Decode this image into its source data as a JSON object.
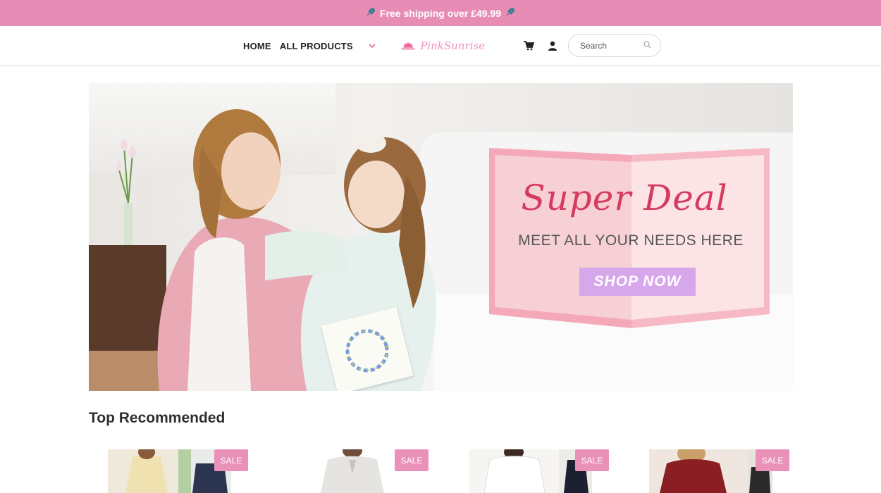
{
  "announcement": {
    "text": "Free shipping over £49.99"
  },
  "nav": {
    "home": "HOME",
    "all_products": "ALL PRODUCTS"
  },
  "logo": {
    "text": "PinkSunrise"
  },
  "search": {
    "placeholder": "Search"
  },
  "hero": {
    "title": "Super Deal",
    "subtitle": "MEET ALL YOUR NEEDS HERE",
    "cta": "SHOP NOW"
  },
  "section": {
    "title": "Top Recommended"
  },
  "products": [
    {
      "badge": "SALE"
    },
    {
      "badge": "SALE"
    },
    {
      "badge": "SALE"
    },
    {
      "badge": "SALE"
    }
  ],
  "colors": {
    "accent": "#e78db5",
    "banner_title": "#d63a5e",
    "cta": "#d7a7ec"
  }
}
